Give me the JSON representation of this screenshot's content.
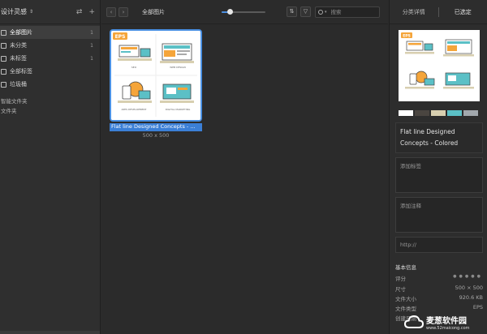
{
  "sidebar": {
    "title": "设计灵感",
    "items": [
      {
        "label": "全部图片",
        "count": "1"
      },
      {
        "label": "未分类",
        "count": "1"
      },
      {
        "label": "未标签",
        "count": "1"
      },
      {
        "label": "全部标签",
        "count": ""
      },
      {
        "label": "垃圾桶",
        "count": ""
      }
    ],
    "sections": [
      "智能文件夹",
      "文件夹"
    ]
  },
  "toolbar": {
    "title": "全部图片",
    "search_placeholder": "搜索",
    "zoom_level": 0.2
  },
  "thumbnail": {
    "name": "Flat line Designed Concepts - ...",
    "dimensions": "500 x 500",
    "badge": "EPS",
    "captions": [
      "SEO",
      "WEB DESIGN",
      "APPS DEVELOPMENT",
      "DIGITAL MARKETING"
    ]
  },
  "panel": {
    "tabs": [
      "分类详情",
      "已选定"
    ],
    "title": "Flat line Designed Concepts - Colored",
    "tags_placeholder": "添加标签",
    "notes_placeholder": "添加注释",
    "url_placeholder": "http://",
    "swatches": [
      "#ffffff",
      "#4a4540",
      "#d8cfb0",
      "#5bc0c6",
      "#a2a8ad"
    ],
    "info_title": "基本信息",
    "info": [
      {
        "label": "评分",
        "value": ""
      },
      {
        "label": "尺寸",
        "value": "500 × 500"
      },
      {
        "label": "文件大小",
        "value": "920.6 KB"
      },
      {
        "label": "文件类型",
        "value": "EPS"
      },
      {
        "label": "创建日期",
        "value": ""
      }
    ]
  },
  "watermark": {
    "name": "麦葱软件园",
    "url": "www.52maicong.com"
  },
  "colors": {
    "accent": "#4a90e2",
    "badge_orange": "#f5a53a"
  }
}
